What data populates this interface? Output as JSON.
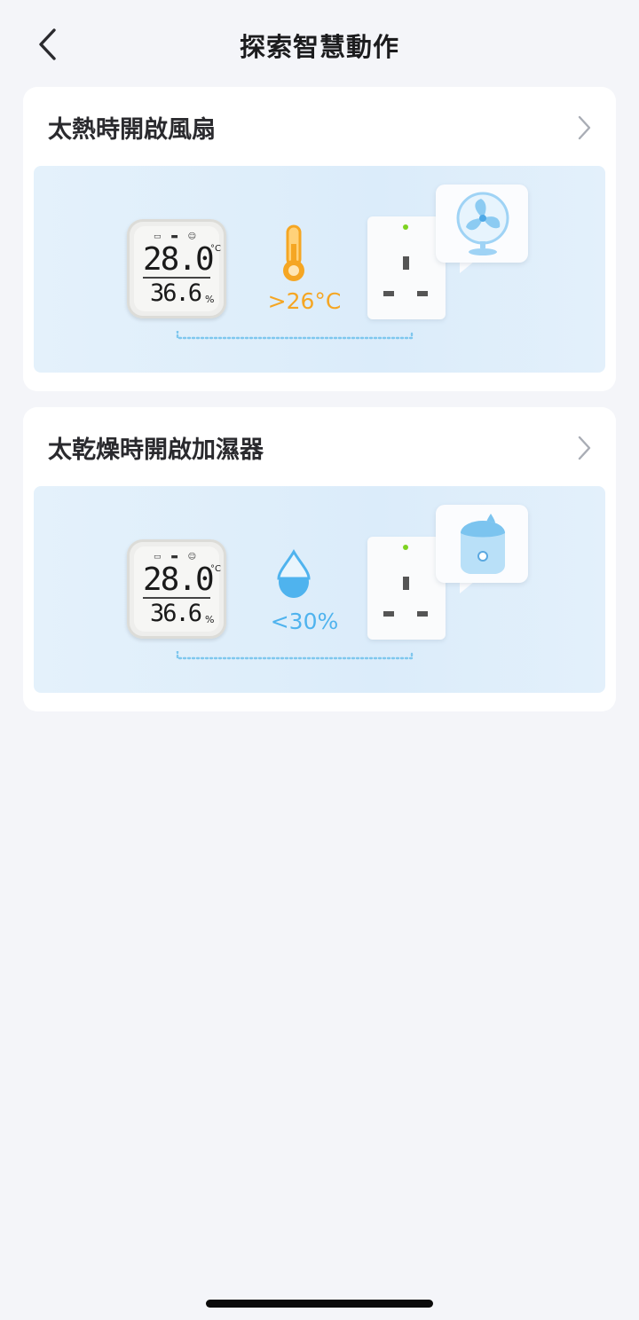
{
  "header": {
    "title": "探索智慧動作",
    "back_icon": "chevron-left-icon"
  },
  "cards": [
    {
      "title": "太熱時開啟風扇",
      "sensor": {
        "icons": "▭ ▬ ☺",
        "temperature": "28.0",
        "temperature_unit": "°C",
        "humidity": "36.6",
        "humidity_unit": "%"
      },
      "condition_icon": "thermometer-icon",
      "condition_text": "&gt;26°C",
      "condition_color": "#f5a623",
      "appliance_icon": "fan-icon"
    },
    {
      "title": "太乾燥時開啟加濕器",
      "sensor": {
        "icons": "▭ ▬ ☺",
        "temperature": "28.0",
        "temperature_unit": "°C",
        "humidity": "36.6",
        "humidity_unit": "%"
      },
      "condition_icon": "water-drop-icon",
      "condition_text": "&lt;30%",
      "condition_color": "#4fb3ee",
      "appliance_icon": "humidifier-icon"
    }
  ],
  "colors": {
    "background": "#f4f5f9",
    "card": "#ffffff",
    "scene": "#dbecfa",
    "accent_blue": "#4fb3ee",
    "accent_orange": "#f5a623",
    "plug_led": "#7ed321"
  }
}
